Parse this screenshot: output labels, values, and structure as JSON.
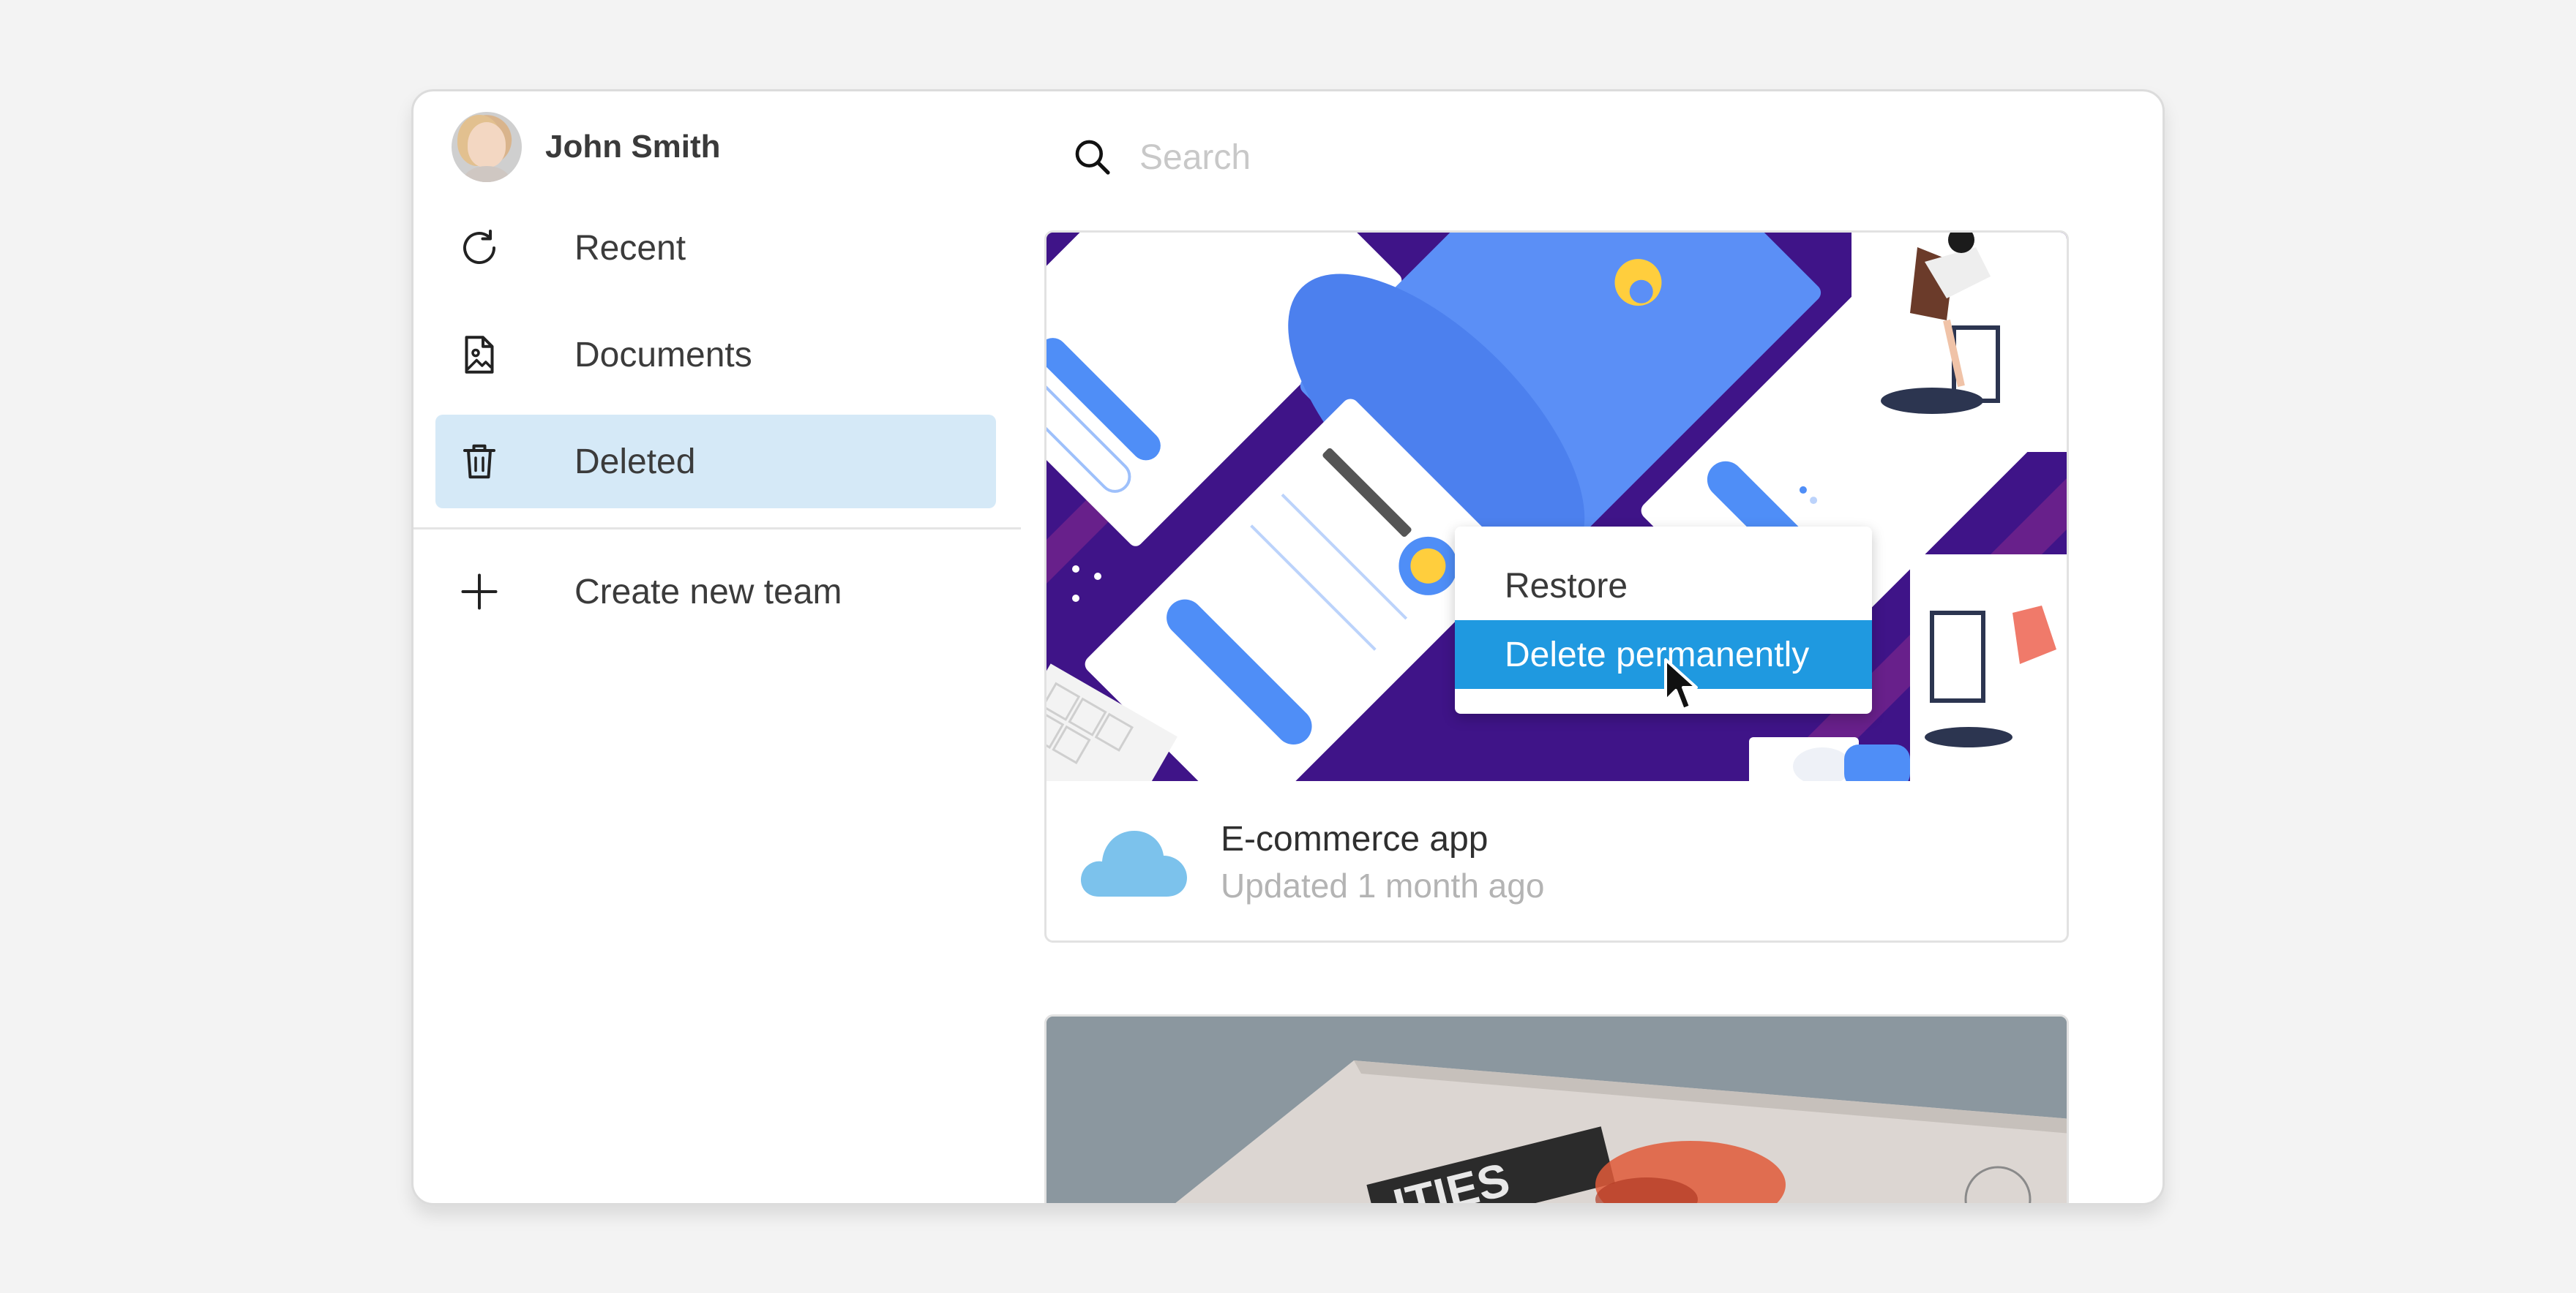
{
  "user": {
    "name": "John Smith"
  },
  "sidebar": {
    "items": [
      {
        "label": "Recent",
        "icon": "refresh-icon"
      },
      {
        "label": "Documents",
        "icon": "document-icon"
      },
      {
        "label": "Deleted",
        "icon": "trash-icon",
        "active": true
      }
    ],
    "create_team_label": "Create new team"
  },
  "search": {
    "placeholder": "Search"
  },
  "cards": [
    {
      "title": "E-commerce app",
      "subtitle": "Updated 1 month ago",
      "icon": "cloud-icon"
    }
  ],
  "context_menu": {
    "items": [
      {
        "label": "Restore"
      },
      {
        "label": "Delete permanently",
        "highlighted": true
      }
    ]
  },
  "colors": {
    "active_nav_bg": "#d5e9f7",
    "menu_highlight": "#1f99e0",
    "cloud": "#7cc2ec"
  }
}
